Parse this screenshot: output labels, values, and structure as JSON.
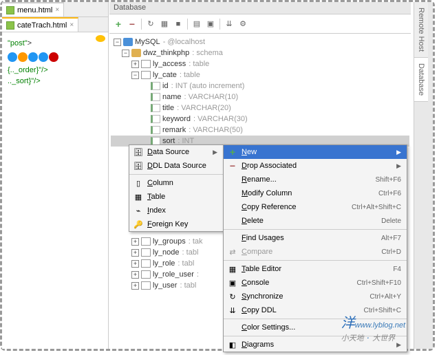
{
  "leftPane": {
    "tabs": [
      {
        "label": "menu.html",
        "active": false
      },
      {
        "label": "cateTrach.html",
        "active": true
      }
    ],
    "code": {
      "line1_attr": "\"post\"",
      "line1_suffix": ">",
      "line2": "{.._order}\"/>",
      "line3": ".._sort}\"/>"
    }
  },
  "dbPane": {
    "title": "Database",
    "connection": {
      "name": "MySQL",
      "host": "@localhost"
    },
    "schema": {
      "name": "dwz_thinkphp",
      "type": "schema"
    },
    "tables": [
      {
        "name": "ly_access",
        "type": "table",
        "expanded": false
      },
      {
        "name": "ly_cate",
        "type": "table",
        "expanded": true,
        "columns": [
          {
            "name": "id",
            "type": "INT (auto increment)"
          },
          {
            "name": "name",
            "type": "VARCHAR(10)"
          },
          {
            "name": "title",
            "type": "VARCHAR(20)"
          },
          {
            "name": "keyword",
            "type": "VARCHAR(30)"
          },
          {
            "name": "remark",
            "type": "VARCHAR(50)"
          },
          {
            "name": "sort",
            "type": "INT"
          }
        ]
      },
      {
        "name": "ly_groups",
        "type": "tak"
      },
      {
        "name": "ly_node",
        "type": "tabl"
      },
      {
        "name": "ly_role",
        "type": "tabl"
      },
      {
        "name": "ly_role_user",
        "type": ""
      },
      {
        "name": "ly_user",
        "type": "tabl"
      }
    ]
  },
  "menu1": {
    "items": [
      {
        "icon": "db",
        "label": "Data Source",
        "arrow": true
      },
      {
        "icon": "db",
        "label": "DDL Data Source"
      },
      {
        "sep": true
      },
      {
        "icon": "col",
        "label": "Column"
      },
      {
        "icon": "tbl",
        "label": "Table"
      },
      {
        "icon": "idx",
        "label": "Index"
      },
      {
        "icon": "fk",
        "label": "Foreign Key"
      }
    ]
  },
  "menu2": {
    "items": [
      {
        "icon": "plus",
        "label": "New",
        "arrow": true,
        "hot": true
      },
      {
        "icon": "minus",
        "label": "Drop Associated",
        "arrow": true
      },
      {
        "label": "Rename...",
        "shortcut": "Shift+F6"
      },
      {
        "label": "Modify Column",
        "shortcut": "Ctrl+F6"
      },
      {
        "label": "Copy Reference",
        "shortcut": "Ctrl+Alt+Shift+C"
      },
      {
        "label": "Delete",
        "shortcut": "Delete"
      },
      {
        "sep": true
      },
      {
        "label": "Find Usages",
        "shortcut": "Alt+F7"
      },
      {
        "icon": "cmp",
        "label": "Compare",
        "shortcut": "Ctrl+D",
        "disabled": true
      },
      {
        "sep": true
      },
      {
        "icon": "tbl",
        "label": "Table Editor",
        "shortcut": "F4"
      },
      {
        "icon": "con",
        "label": "Console",
        "shortcut": "Ctrl+Shift+F10"
      },
      {
        "icon": "syn",
        "label": "Synchronize",
        "shortcut": "Ctrl+Alt+Y"
      },
      {
        "icon": "ddl",
        "label": "Copy DDL",
        "shortcut": "Ctrl+Shift+C"
      },
      {
        "sep": true
      },
      {
        "label": "Color Settings..."
      },
      {
        "sep": true
      },
      {
        "icon": "dia",
        "label": "Diagrams",
        "arrow": true
      }
    ]
  },
  "rightTabs": [
    {
      "label": "Remote Host",
      "active": false
    },
    {
      "label": "Database",
      "active": true
    }
  ],
  "watermark": {
    "url": "www.lyblog.net",
    "cn1": "小天地",
    "cn2": "大世界"
  }
}
